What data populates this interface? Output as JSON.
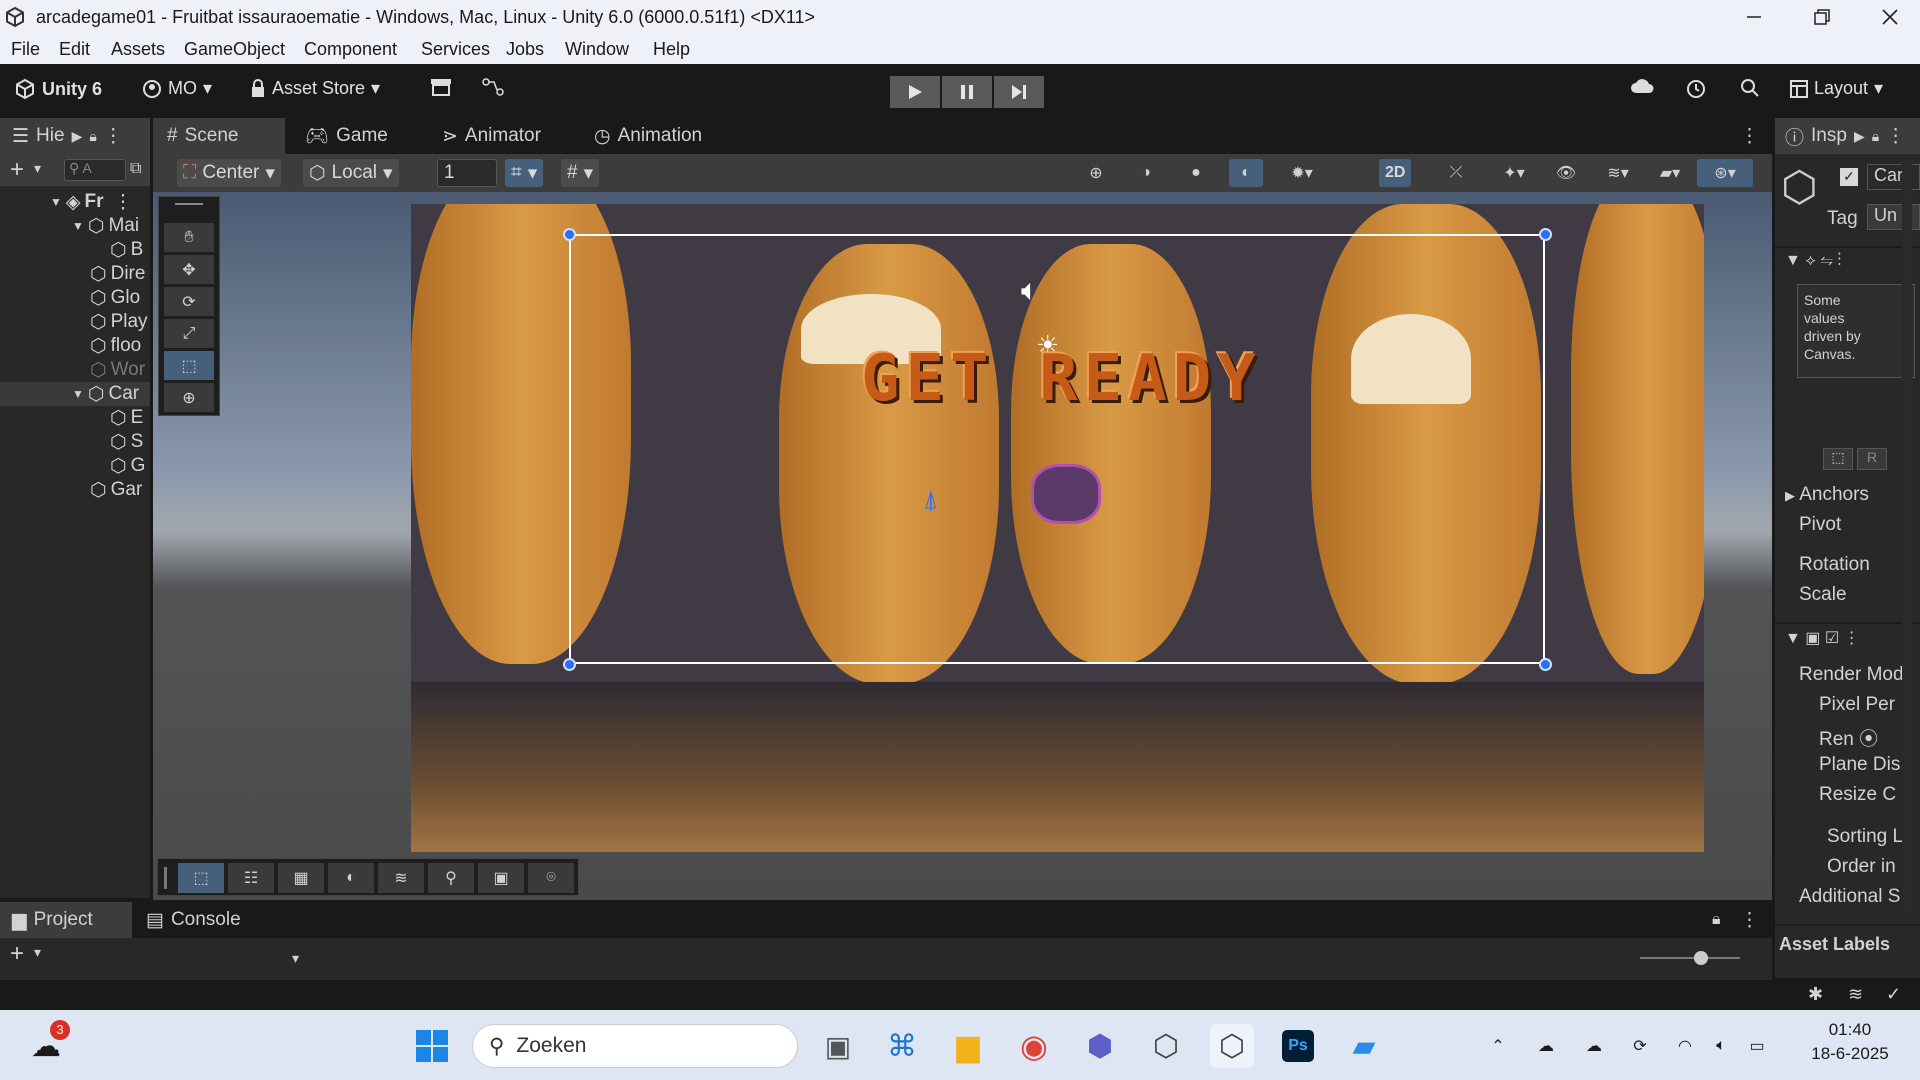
{
  "window": {
    "title": "arcadegame01 - Fruitbat issauraoematie - Windows, Mac, Linux - Unity 6.0 (6000.0.51f1) <DX11>"
  },
  "menu": [
    "File",
    "Edit",
    "Assets",
    "GameObject",
    "Component",
    "Services",
    "Jobs",
    "Window",
    "Help"
  ],
  "toolbar": {
    "brand": "Unity 6",
    "account": "MO",
    "asset_store": "Asset Store",
    "layout": "Layout"
  },
  "hierarchy": {
    "tab": "Hie",
    "search_placeholder": "A",
    "items": [
      {
        "label": "Fr"
      },
      {
        "label": "Mai"
      },
      {
        "label": "B"
      },
      {
        "label": "Dire"
      },
      {
        "label": "Glo"
      },
      {
        "label": "Play"
      },
      {
        "label": "floo"
      },
      {
        "label": "Wor"
      },
      {
        "label": "Car"
      },
      {
        "label": "E"
      },
      {
        "label": "S"
      },
      {
        "label": "G"
      },
      {
        "label": "Gar"
      }
    ]
  },
  "center_tabs": [
    "Scene",
    "Game",
    "Animator",
    "Animation"
  ],
  "scene_toolbar": {
    "pivot": "Center",
    "space": "Local",
    "snap_value": "1",
    "mode_2d": "2D"
  },
  "scene": {
    "banner_text": "GET READY"
  },
  "inspector": {
    "tab": "Insp",
    "name_value": "Car",
    "tag_label": "Tag",
    "tag_value": "Un",
    "note": [
      "Some",
      "values",
      "driven by",
      "Canvas."
    ],
    "rect_btn_r": "R",
    "rect_labels": [
      "Anchors",
      "Pivot",
      "Rotation",
      "Scale"
    ],
    "canvas_labels": [
      "Render Mod",
      "Pixel Per",
      "Ren",
      "Plane Dis",
      "Resize C",
      "Sorting L",
      "Order in",
      "Additional S"
    ],
    "asset_labels": "Asset Labels"
  },
  "bottom_tabs": [
    "Project",
    "Console"
  ],
  "taskbar": {
    "search_placeholder": "Zoeken",
    "weather_badge": "3",
    "time": "01:40",
    "date": "18-6-2025"
  },
  "colors": {
    "accent_blue": "#2a6ff0",
    "banner_orange": "#c65a17"
  }
}
